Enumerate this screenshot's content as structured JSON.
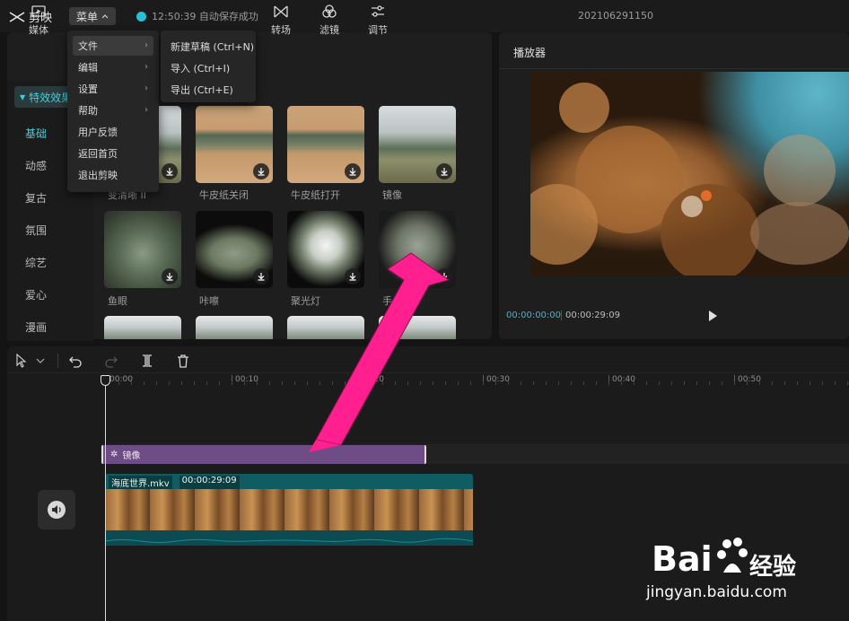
{
  "topbar": {
    "app_name": "剪映",
    "menu_label": "菜单",
    "save_status": "12:50:39 自动保存成功",
    "project_name": "202106291150"
  },
  "tools": [
    "媒体",
    "转场",
    "滤镜",
    "调节"
  ],
  "categories": {
    "active": "特效效果",
    "items": [
      "基础",
      "动感",
      "复古",
      "氛围",
      "综艺",
      "爱心",
      "漫画"
    ]
  },
  "effects": [
    {
      "label": "变清晰 II"
    },
    {
      "label": "牛皮纸关闭"
    },
    {
      "label": "牛皮纸打开"
    },
    {
      "label": "镜像"
    },
    {
      "label": "鱼眼"
    },
    {
      "label": "咔嚓"
    },
    {
      "label": "聚光灯"
    },
    {
      "label": "手"
    }
  ],
  "menu": {
    "items": [
      "文件",
      "编辑",
      "设置",
      "帮助",
      "用户反馈",
      "返回首页",
      "退出剪映"
    ],
    "file_submenu": [
      "新建草稿 (Ctrl+N)",
      "导入 (Ctrl+I)",
      "导出 (Ctrl+E)"
    ]
  },
  "player": {
    "title": "播放器",
    "current_time": "00:00:00:00",
    "total_time": "00:00:29:09"
  },
  "timeline": {
    "ruler_labels": [
      "00:00",
      "00:10",
      "00:20",
      "00:30",
      "00:40",
      "00:50"
    ],
    "effect_clip": "镜像",
    "video_clip_name": "海底世界.mkv",
    "video_clip_duration": "00:00:29:09"
  },
  "watermark": {
    "brand_left": "Bai",
    "brand_right": "经验",
    "site": "jingyan.baidu.com"
  },
  "colors": {
    "accent": "#2bbfd4",
    "effect_clip": "#6e4c86",
    "video_clip": "#0f5c63",
    "arrow": "#ff1f8e"
  }
}
